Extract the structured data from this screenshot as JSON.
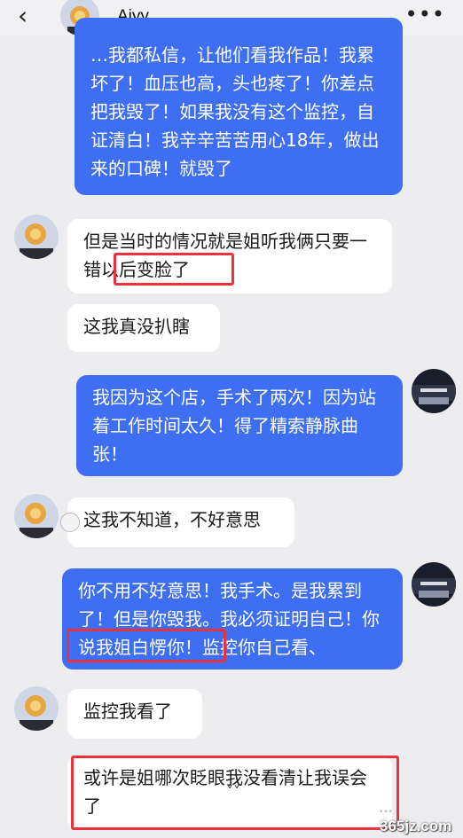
{
  "header": {
    "back_icon": "chevron-left-icon",
    "title": "Aiyy",
    "more_icon": "more-dots-icon"
  },
  "messages": [
    {
      "side": "out",
      "text": "…我都私信，让他们看我作品！我累坏了！血压也高，头也疼了！你差点把我毁了！如果我没有这个监控，自证清白！我辛辛苦苦用心18年，做出来的口碑！就毁了"
    },
    {
      "side": "in",
      "text": "但是当时的情况就是姐听我俩只要一错以后变脸了"
    },
    {
      "side": "in",
      "text": "这我真没扒瞎"
    },
    {
      "side": "out",
      "text": "我因为这个店，手术了两次！因为站着工作时间太久！得了精索静脉曲张！"
    },
    {
      "side": "in",
      "text": "这我不知道，不好意思"
    },
    {
      "side": "out",
      "text": "你不用不好意思！我手术。是我累到了！但是你毁我。我必须证明自己！你说我姐白愣你！监控你自己看、"
    },
    {
      "side": "in",
      "text": "监控我看了"
    },
    {
      "side": "in",
      "text": "或许是姐哪次眨眼我没看清让我误会了"
    }
  ],
  "scroll_down_icon": "double-chevron-down-icon",
  "watermark": "365jz.com",
  "colors": {
    "outgoing": "#3e6ff3",
    "incoming": "#ffffff",
    "highlight": "#e9323a",
    "background": "#ededf0"
  }
}
